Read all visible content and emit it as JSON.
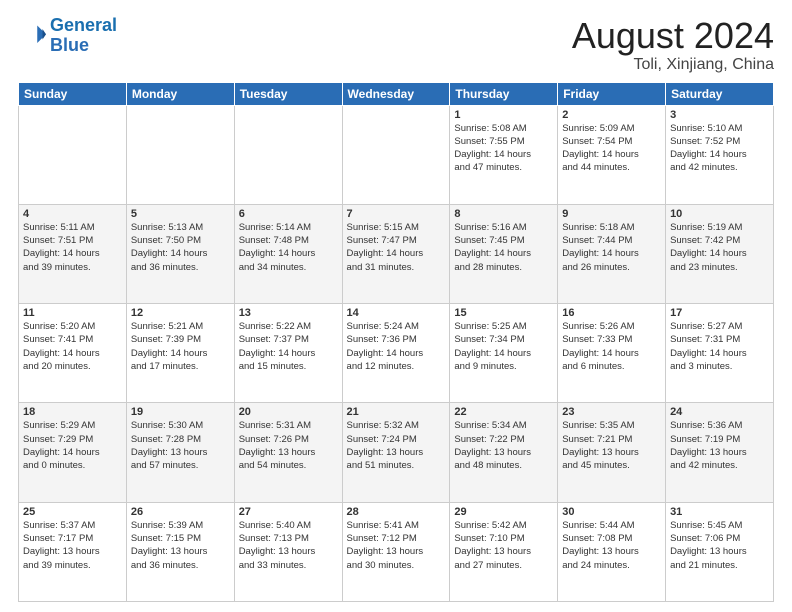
{
  "logo": {
    "line1": "General",
    "line2": "Blue"
  },
  "title": "August 2024",
  "location": "Toli, Xinjiang, China",
  "days_of_week": [
    "Sunday",
    "Monday",
    "Tuesday",
    "Wednesday",
    "Thursday",
    "Friday",
    "Saturday"
  ],
  "weeks": [
    [
      {
        "day": "",
        "info": ""
      },
      {
        "day": "",
        "info": ""
      },
      {
        "day": "",
        "info": ""
      },
      {
        "day": "",
        "info": ""
      },
      {
        "day": "1",
        "info": "Sunrise: 5:08 AM\nSunset: 7:55 PM\nDaylight: 14 hours\nand 47 minutes."
      },
      {
        "day": "2",
        "info": "Sunrise: 5:09 AM\nSunset: 7:54 PM\nDaylight: 14 hours\nand 44 minutes."
      },
      {
        "day": "3",
        "info": "Sunrise: 5:10 AM\nSunset: 7:52 PM\nDaylight: 14 hours\nand 42 minutes."
      }
    ],
    [
      {
        "day": "4",
        "info": "Sunrise: 5:11 AM\nSunset: 7:51 PM\nDaylight: 14 hours\nand 39 minutes."
      },
      {
        "day": "5",
        "info": "Sunrise: 5:13 AM\nSunset: 7:50 PM\nDaylight: 14 hours\nand 36 minutes."
      },
      {
        "day": "6",
        "info": "Sunrise: 5:14 AM\nSunset: 7:48 PM\nDaylight: 14 hours\nand 34 minutes."
      },
      {
        "day": "7",
        "info": "Sunrise: 5:15 AM\nSunset: 7:47 PM\nDaylight: 14 hours\nand 31 minutes."
      },
      {
        "day": "8",
        "info": "Sunrise: 5:16 AM\nSunset: 7:45 PM\nDaylight: 14 hours\nand 28 minutes."
      },
      {
        "day": "9",
        "info": "Sunrise: 5:18 AM\nSunset: 7:44 PM\nDaylight: 14 hours\nand 26 minutes."
      },
      {
        "day": "10",
        "info": "Sunrise: 5:19 AM\nSunset: 7:42 PM\nDaylight: 14 hours\nand 23 minutes."
      }
    ],
    [
      {
        "day": "11",
        "info": "Sunrise: 5:20 AM\nSunset: 7:41 PM\nDaylight: 14 hours\nand 20 minutes."
      },
      {
        "day": "12",
        "info": "Sunrise: 5:21 AM\nSunset: 7:39 PM\nDaylight: 14 hours\nand 17 minutes."
      },
      {
        "day": "13",
        "info": "Sunrise: 5:22 AM\nSunset: 7:37 PM\nDaylight: 14 hours\nand 15 minutes."
      },
      {
        "day": "14",
        "info": "Sunrise: 5:24 AM\nSunset: 7:36 PM\nDaylight: 14 hours\nand 12 minutes."
      },
      {
        "day": "15",
        "info": "Sunrise: 5:25 AM\nSunset: 7:34 PM\nDaylight: 14 hours\nand 9 minutes."
      },
      {
        "day": "16",
        "info": "Sunrise: 5:26 AM\nSunset: 7:33 PM\nDaylight: 14 hours\nand 6 minutes."
      },
      {
        "day": "17",
        "info": "Sunrise: 5:27 AM\nSunset: 7:31 PM\nDaylight: 14 hours\nand 3 minutes."
      }
    ],
    [
      {
        "day": "18",
        "info": "Sunrise: 5:29 AM\nSunset: 7:29 PM\nDaylight: 14 hours\nand 0 minutes."
      },
      {
        "day": "19",
        "info": "Sunrise: 5:30 AM\nSunset: 7:28 PM\nDaylight: 13 hours\nand 57 minutes."
      },
      {
        "day": "20",
        "info": "Sunrise: 5:31 AM\nSunset: 7:26 PM\nDaylight: 13 hours\nand 54 minutes."
      },
      {
        "day": "21",
        "info": "Sunrise: 5:32 AM\nSunset: 7:24 PM\nDaylight: 13 hours\nand 51 minutes."
      },
      {
        "day": "22",
        "info": "Sunrise: 5:34 AM\nSunset: 7:22 PM\nDaylight: 13 hours\nand 48 minutes."
      },
      {
        "day": "23",
        "info": "Sunrise: 5:35 AM\nSunset: 7:21 PM\nDaylight: 13 hours\nand 45 minutes."
      },
      {
        "day": "24",
        "info": "Sunrise: 5:36 AM\nSunset: 7:19 PM\nDaylight: 13 hours\nand 42 minutes."
      }
    ],
    [
      {
        "day": "25",
        "info": "Sunrise: 5:37 AM\nSunset: 7:17 PM\nDaylight: 13 hours\nand 39 minutes."
      },
      {
        "day": "26",
        "info": "Sunrise: 5:39 AM\nSunset: 7:15 PM\nDaylight: 13 hours\nand 36 minutes."
      },
      {
        "day": "27",
        "info": "Sunrise: 5:40 AM\nSunset: 7:13 PM\nDaylight: 13 hours\nand 33 minutes."
      },
      {
        "day": "28",
        "info": "Sunrise: 5:41 AM\nSunset: 7:12 PM\nDaylight: 13 hours\nand 30 minutes."
      },
      {
        "day": "29",
        "info": "Sunrise: 5:42 AM\nSunset: 7:10 PM\nDaylight: 13 hours\nand 27 minutes."
      },
      {
        "day": "30",
        "info": "Sunrise: 5:44 AM\nSunset: 7:08 PM\nDaylight: 13 hours\nand 24 minutes."
      },
      {
        "day": "31",
        "info": "Sunrise: 5:45 AM\nSunset: 7:06 PM\nDaylight: 13 hours\nand 21 minutes."
      }
    ]
  ]
}
